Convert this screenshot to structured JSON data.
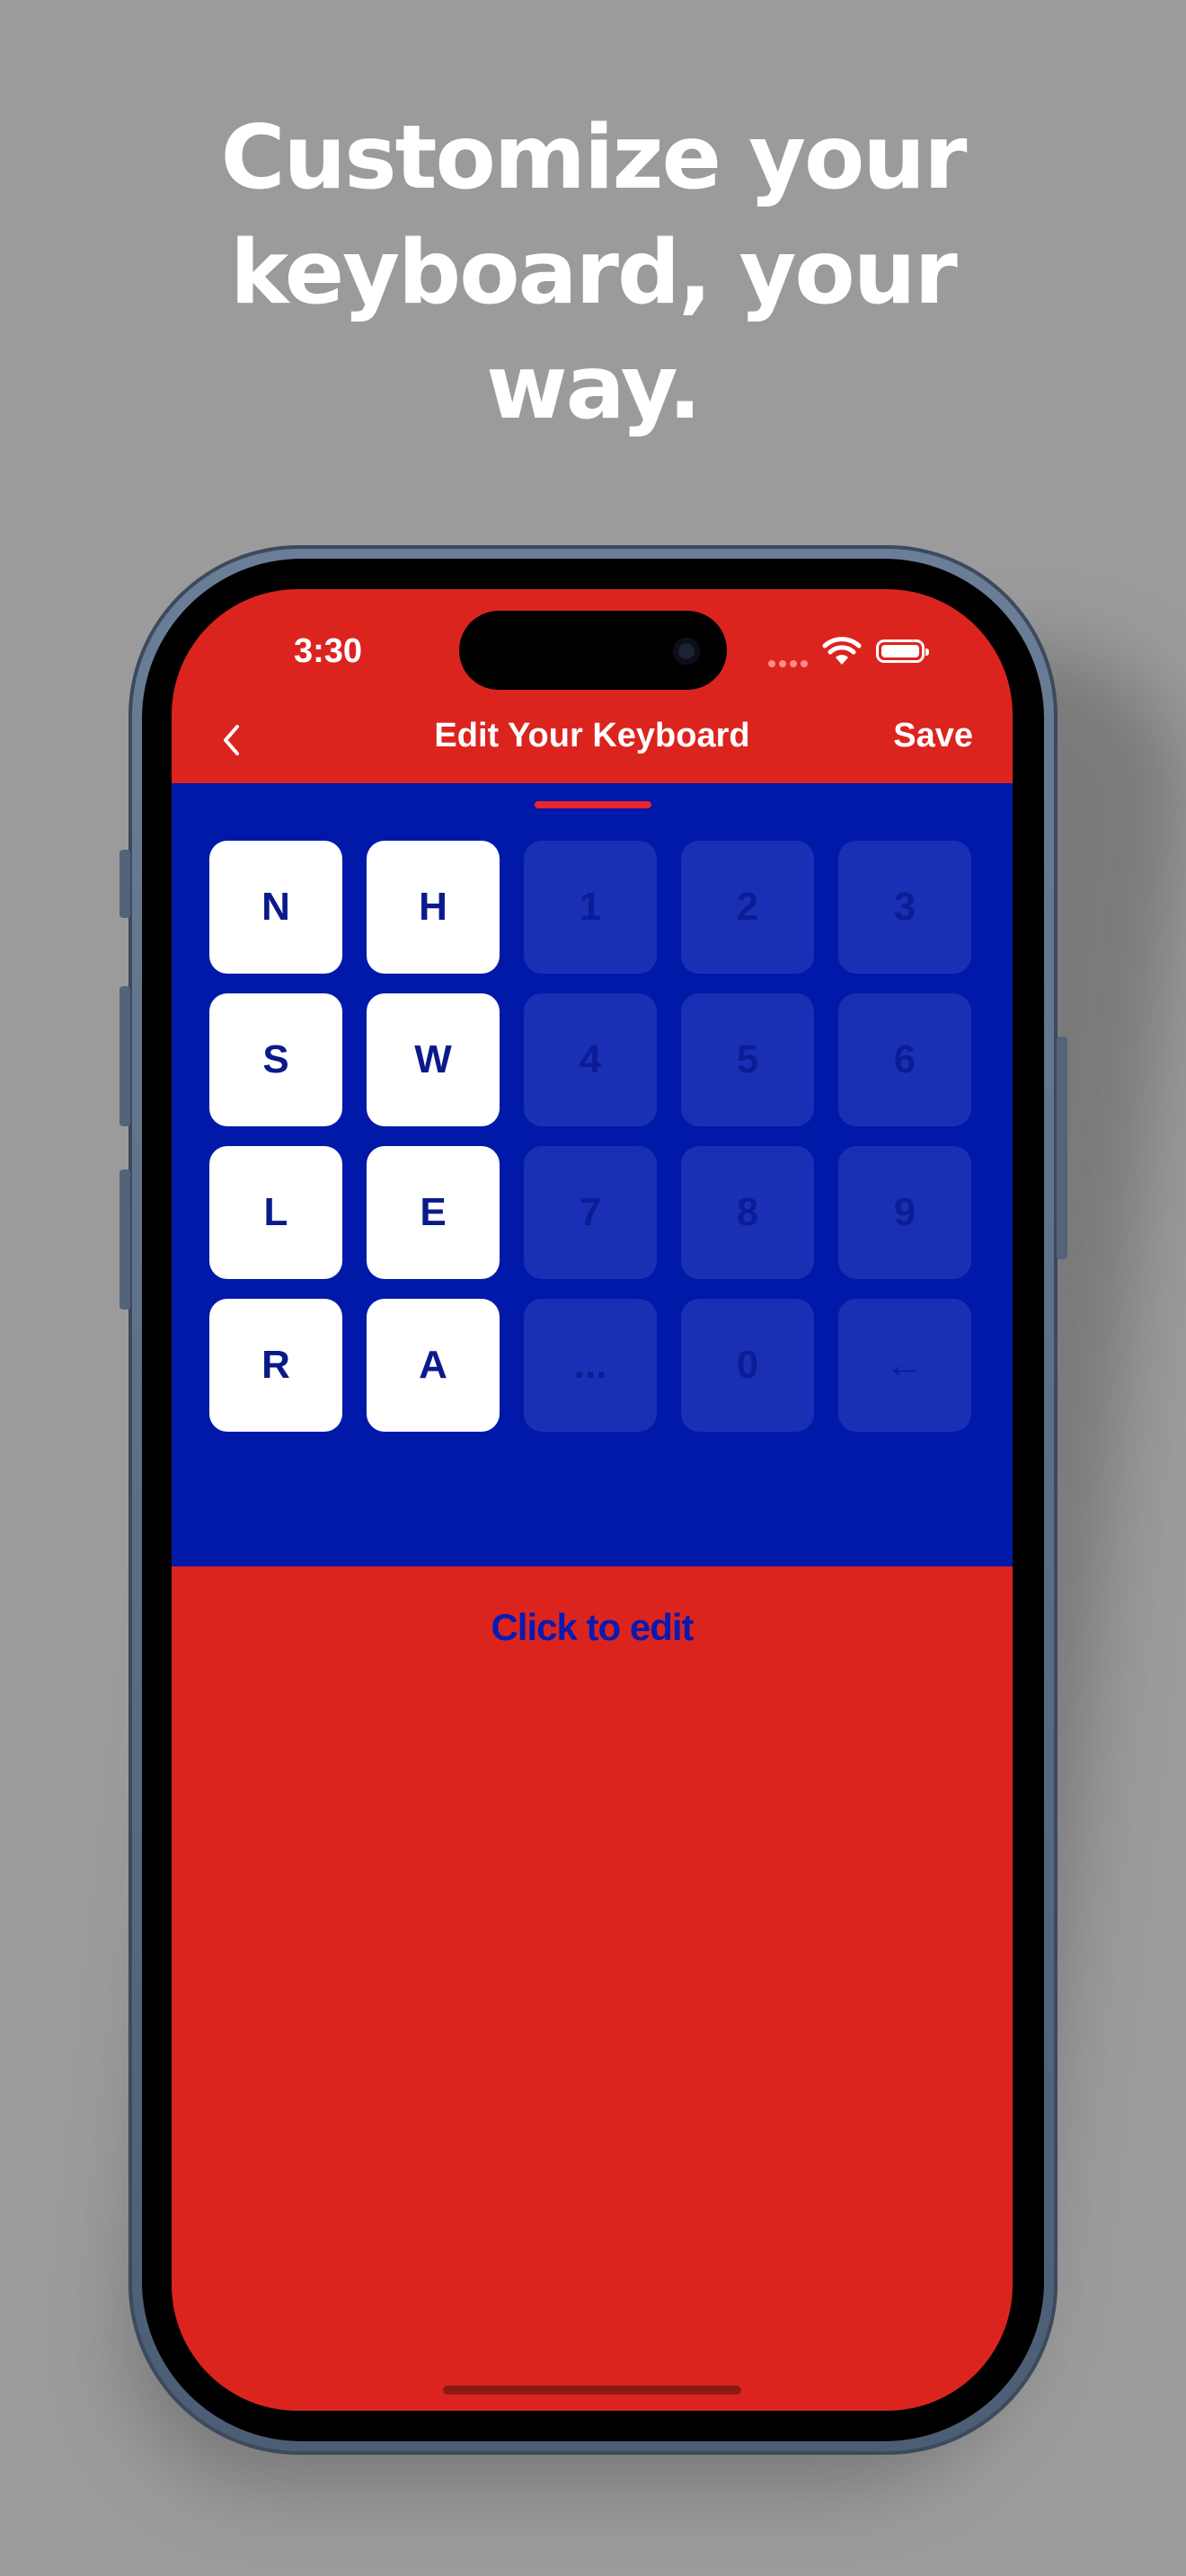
{
  "headline": [
    "Customize your",
    "keyboard, your",
    "way."
  ],
  "status_bar": {
    "time": "3:30"
  },
  "nav": {
    "title": "Edit Your Keyboard",
    "save_label": "Save",
    "back_icon": "chevron-left-icon"
  },
  "keyboard": {
    "keys": [
      {
        "label": "N",
        "enabled": true
      },
      {
        "label": "H",
        "enabled": true
      },
      {
        "label": "1",
        "enabled": false
      },
      {
        "label": "2",
        "enabled": false
      },
      {
        "label": "3",
        "enabled": false
      },
      {
        "label": "S",
        "enabled": true
      },
      {
        "label": "W",
        "enabled": true
      },
      {
        "label": "4",
        "enabled": false
      },
      {
        "label": "5",
        "enabled": false
      },
      {
        "label": "6",
        "enabled": false
      },
      {
        "label": "L",
        "enabled": true
      },
      {
        "label": "E",
        "enabled": true
      },
      {
        "label": "7",
        "enabled": false
      },
      {
        "label": "8",
        "enabled": false
      },
      {
        "label": "9",
        "enabled": false
      },
      {
        "label": "R",
        "enabled": true
      },
      {
        "label": "A",
        "enabled": true
      },
      {
        "label": "...",
        "enabled": false
      },
      {
        "label": "0",
        "enabled": false
      },
      {
        "label": "←",
        "enabled": false
      }
    ]
  },
  "edit_prompt": "Click to edit",
  "colors": {
    "background": "#9b9b9b",
    "screen_red": "#dc241f",
    "keyboard_blue": "#0019a8",
    "key_white": "#ffffff",
    "key_text": "#0a1a8c"
  }
}
